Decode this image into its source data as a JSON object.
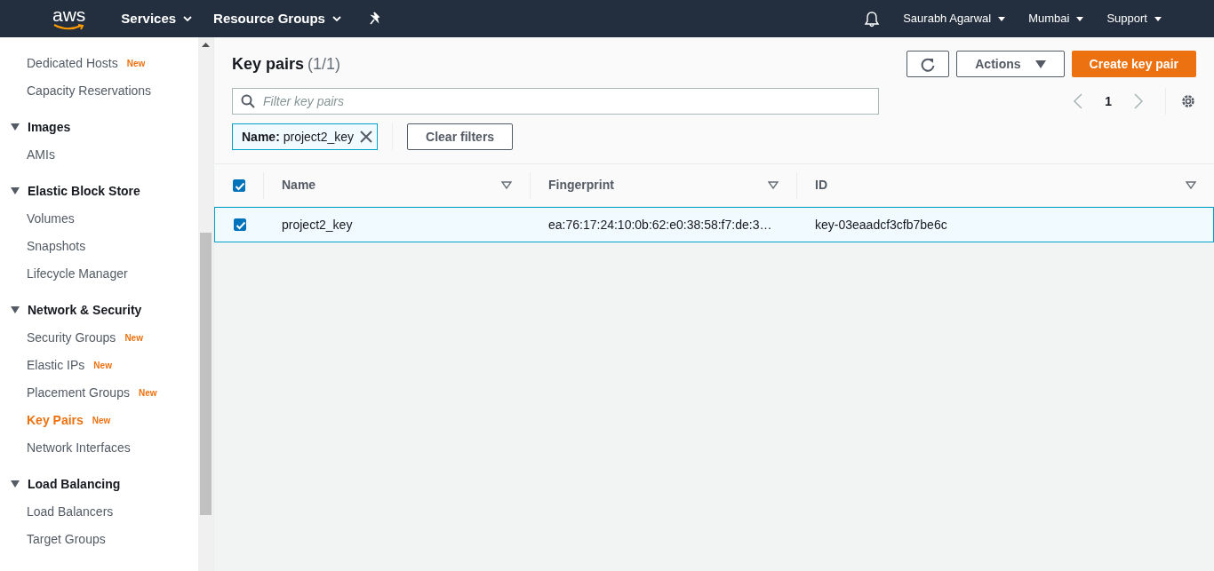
{
  "top_nav": {
    "logo": "aws",
    "menus": [
      {
        "label": "Services"
      },
      {
        "label": "Resource Groups"
      }
    ],
    "account": "Saurabh Agarwal",
    "region": "Mumbai",
    "support": "Support"
  },
  "sidebar": {
    "sections": [
      {
        "items": [
          {
            "label": "Dedicated Hosts",
            "badge": "New",
            "selected": false
          },
          {
            "label": "Capacity Reservations",
            "selected": false
          }
        ]
      },
      {
        "title": "Images",
        "expanded": true,
        "items": [
          {
            "label": "AMIs",
            "selected": false
          }
        ]
      },
      {
        "title": "Elastic Block Store",
        "expanded": true,
        "items": [
          {
            "label": "Volumes",
            "selected": false
          },
          {
            "label": "Snapshots",
            "selected": false
          },
          {
            "label": "Lifecycle Manager",
            "selected": false
          }
        ]
      },
      {
        "title": "Network & Security",
        "expanded": true,
        "items": [
          {
            "label": "Security Groups",
            "badge": "New",
            "selected": false
          },
          {
            "label": "Elastic IPs",
            "badge": "New",
            "selected": false
          },
          {
            "label": "Placement Groups",
            "badge": "New",
            "selected": false
          },
          {
            "label": "Key Pairs",
            "badge": "New",
            "selected": true
          },
          {
            "label": "Network Interfaces",
            "selected": false
          }
        ]
      },
      {
        "title": "Load Balancing",
        "expanded": true,
        "items": [
          {
            "label": "Load Balancers",
            "selected": false
          },
          {
            "label": "Target Groups",
            "selected": false
          }
        ]
      }
    ]
  },
  "header": {
    "title": "Key pairs",
    "count": "(1/1)",
    "actions_button": "Actions",
    "create_button": "Create key pair"
  },
  "filter": {
    "placeholder": "Filter key pairs",
    "token_key": "Name:",
    "token_value": "project2_key",
    "clear_button": "Clear filters"
  },
  "pagination": {
    "page": "1"
  },
  "table": {
    "all_checked": true,
    "columns": [
      "Name",
      "Fingerprint",
      "ID"
    ],
    "rows": [
      {
        "checked": true,
        "selected": true,
        "cells": [
          "project2_key",
          "ea:76:17:24:10:0b:62:e0:38:58:f7:de:3…",
          "key-03eaadcf3cfb7be6c"
        ]
      }
    ]
  }
}
